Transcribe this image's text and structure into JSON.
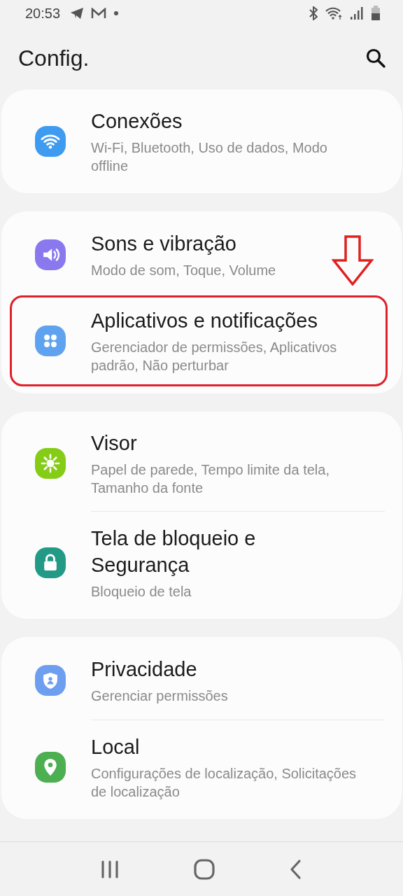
{
  "status_bar": {
    "time": "20:53"
  },
  "header": {
    "title": "Config."
  },
  "groups": [
    {
      "items": [
        {
          "title": "Conexões",
          "subtitle": "Wi-Fi, Bluetooth, Uso de dados, Modo offline",
          "kind": "wifi",
          "color": "#3e9bf0",
          "highlighted": false,
          "arrow": false
        }
      ]
    },
    {
      "items": [
        {
          "title": "Sons e vibração",
          "subtitle": "Modo de som, Toque, Volume",
          "kind": "sound",
          "color": "#8a78ef",
          "highlighted": false,
          "arrow": true
        },
        {
          "title": "Aplicativos e notificações",
          "subtitle": "Gerenciador de permissões, Aplicativos padrão, Não perturbar",
          "kind": "apps",
          "color": "#5fa3f0",
          "highlighted": true,
          "arrow": false
        }
      ]
    },
    {
      "items": [
        {
          "title": "Visor",
          "subtitle": "Papel de parede, Tempo limite da tela, Tamanho da fonte",
          "kind": "sun",
          "color": "#84cc16",
          "highlighted": false,
          "arrow": false
        },
        {
          "title": "Tela de bloqueio e Segurança",
          "subtitle": "Bloqueio de tela",
          "kind": "lock",
          "color": "#229a86",
          "highlighted": false,
          "arrow": false
        }
      ]
    },
    {
      "items": [
        {
          "title": "Privacidade",
          "subtitle": "Gerenciar permissões",
          "kind": "shield",
          "color": "#6d9ef0",
          "highlighted": false,
          "arrow": false
        },
        {
          "title": "Local",
          "subtitle": "Configurações de localização, Solicitações de localização",
          "kind": "pin",
          "color": "#4caf50",
          "highlighted": false,
          "arrow": false
        }
      ]
    }
  ]
}
